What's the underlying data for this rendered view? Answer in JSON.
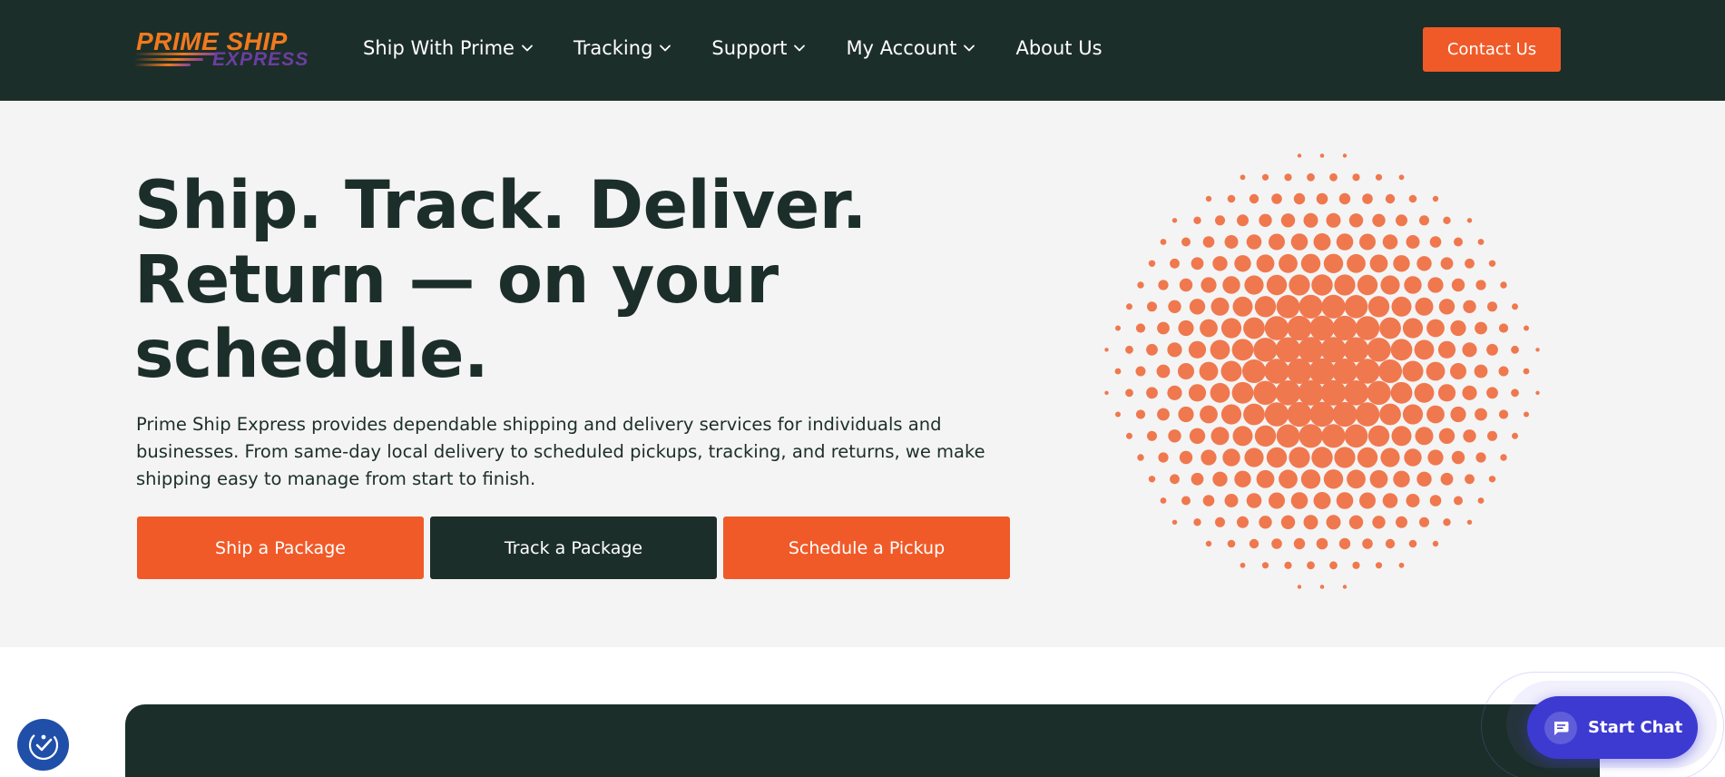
{
  "logo": {
    "line1": "PRIME SHIP",
    "line2": "EXPRESS"
  },
  "nav": {
    "items": [
      {
        "label": "Ship With Prime",
        "has_dropdown": true
      },
      {
        "label": "Tracking",
        "has_dropdown": true
      },
      {
        "label": "Support",
        "has_dropdown": true
      },
      {
        "label": "My Account",
        "has_dropdown": true
      },
      {
        "label": "About Us",
        "has_dropdown": false
      }
    ],
    "contact_label": "Contact Us"
  },
  "hero": {
    "title_line1": "Ship. Track. Deliver.",
    "title_line2": "Return — on your",
    "title_line3": "schedule.",
    "description": "Prime Ship Express provides dependable shipping and delivery services for individuals and businesses. From same-day local delivery to scheduled pickups, tracking, and returns, we make shipping easy to manage from start to finish.",
    "buttons": [
      "Ship a Package",
      "Track a Package",
      "Schedule a Pickup"
    ]
  },
  "chat": {
    "label": "Start Chat"
  },
  "colors": {
    "primary_dark": "#1c2e29",
    "accent_orange": "#f05a28",
    "dot_orange": "#f0784e",
    "chat_purple": "#3d3ad2",
    "a11y_blue": "#1f4fa8",
    "hero_bg": "#f4f4f4"
  },
  "icons": {
    "nav_dropdown": "chevron-down-icon",
    "chat": "chat-bubble-icon",
    "accessibility": "accessibility-icon",
    "hero_graphic": "halftone-dot-sphere"
  }
}
